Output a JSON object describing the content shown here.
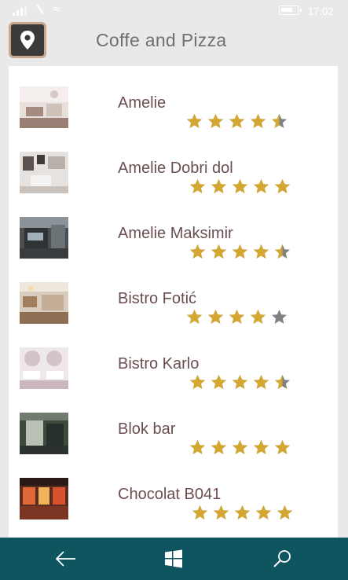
{
  "status": {
    "time": "17:02"
  },
  "header": {
    "title": "Coffe and Pizza",
    "logo_icon": "map-pin-icon"
  },
  "colors": {
    "accent": "#0e5560",
    "star_gold": "#d4a731",
    "star_gray": "#808080",
    "name_text": "#6b4f50"
  },
  "places": [
    {
      "name": "Amelie",
      "rating": 4.5
    },
    {
      "name": "Amelie Dobri dol",
      "rating": 5
    },
    {
      "name": "Amelie Maksimir",
      "rating": 4.5
    },
    {
      "name": "Bistro Fotić",
      "rating": 4
    },
    {
      "name": "Bistro Karlo",
      "rating": 4.5
    },
    {
      "name": "Blok bar",
      "rating": 5
    },
    {
      "name": "Chocolat B041",
      "rating": 5
    }
  ],
  "navbar": {
    "back_icon": "back-arrow-icon",
    "home_icon": "windows-logo-icon",
    "search_icon": "search-icon"
  }
}
